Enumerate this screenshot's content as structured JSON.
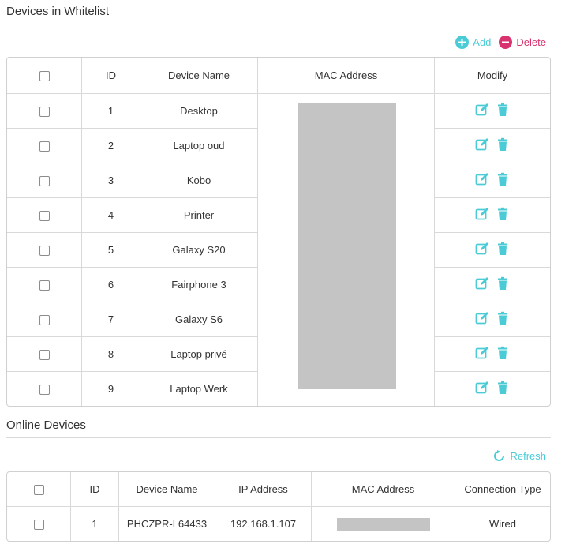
{
  "whitelist": {
    "title": "Devices in Whitelist",
    "add_label": "Add",
    "delete_label": "Delete",
    "columns": [
      "ID",
      "Device Name",
      "MAC Address",
      "Modify"
    ],
    "rows": [
      {
        "id": "1",
        "name": "Desktop"
      },
      {
        "id": "2",
        "name": "Laptop oud"
      },
      {
        "id": "3",
        "name": "Kobo"
      },
      {
        "id": "4",
        "name": "Printer"
      },
      {
        "id": "5",
        "name": "Galaxy S20"
      },
      {
        "id": "6",
        "name": "Fairphone 3"
      },
      {
        "id": "7",
        "name": "Galaxy S6"
      },
      {
        "id": "8",
        "name": "Laptop privé"
      },
      {
        "id": "9",
        "name": "Laptop Werk"
      }
    ]
  },
  "online": {
    "title": "Online Devices",
    "refresh_label": "Refresh",
    "columns": [
      "ID",
      "Device Name",
      "IP Address",
      "MAC Address",
      "Connection Type"
    ],
    "rows": [
      {
        "id": "1",
        "name": "PHCZPR-L64433",
        "ip": "192.168.1.107",
        "connection": "Wired"
      }
    ]
  },
  "colors": {
    "accent": "#4acbd6",
    "delete": "#d8336e",
    "redaction": "#c4c4c4"
  }
}
